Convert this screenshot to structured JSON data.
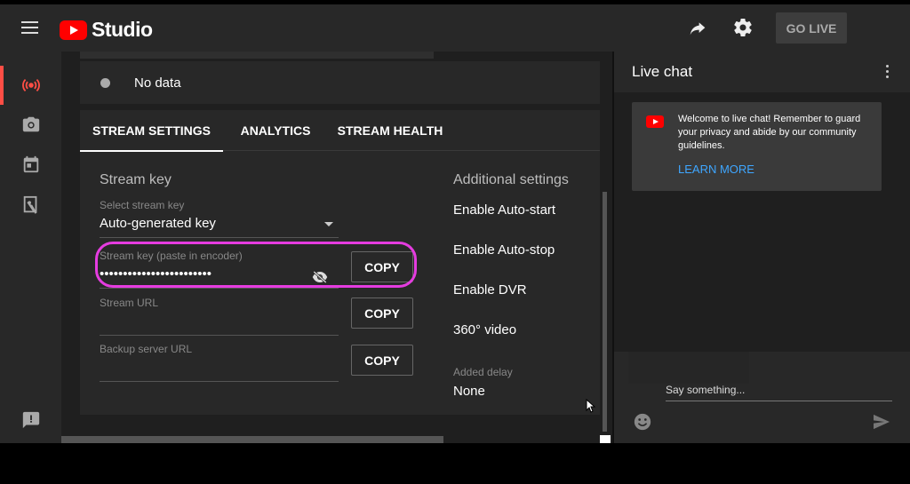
{
  "header": {
    "app_name": "Studio",
    "go_live_label": "GO LIVE"
  },
  "rail": {
    "items": [
      {
        "icon": "live-broadcast-icon",
        "active": true
      },
      {
        "icon": "camera-icon",
        "active": false
      },
      {
        "icon": "calendar-icon",
        "active": false
      },
      {
        "icon": "manage-icon",
        "active": false
      },
      {
        "icon": "feedback-icon",
        "active": false
      }
    ]
  },
  "status": {
    "text": "No data"
  },
  "tabs": [
    {
      "label": "STREAM SETTINGS",
      "active": true
    },
    {
      "label": "ANALYTICS",
      "active": false
    },
    {
      "label": "STREAM HEALTH",
      "active": false
    }
  ],
  "stream_key_section": {
    "title": "Stream key",
    "select_label": "Select stream key",
    "select_value": "Auto-generated key",
    "key_label": "Stream key (paste in encoder)",
    "key_value": "••••••••••••••••••••••••",
    "url_label": "Stream URL",
    "url_value": "",
    "backup_label": "Backup server URL",
    "backup_value": "",
    "copy_label": "COPY"
  },
  "additional_settings": {
    "title": "Additional settings",
    "auto_start": "Enable Auto-start",
    "auto_stop": "Enable Auto-stop",
    "dvr": "Enable DVR",
    "video360": "360° video",
    "delay_label": "Added delay",
    "delay_value": "None"
  },
  "chat": {
    "title": "Live chat",
    "welcome_text": "Welcome to live chat! Remember to guard your privacy and abide by our community guidelines.",
    "learn_more": "LEARN MORE",
    "input_placeholder": "Say something..."
  },
  "colors": {
    "accent_red": "#ff0000",
    "link_blue": "#3ea6ff",
    "highlight_magenta": "#e53ce0"
  }
}
